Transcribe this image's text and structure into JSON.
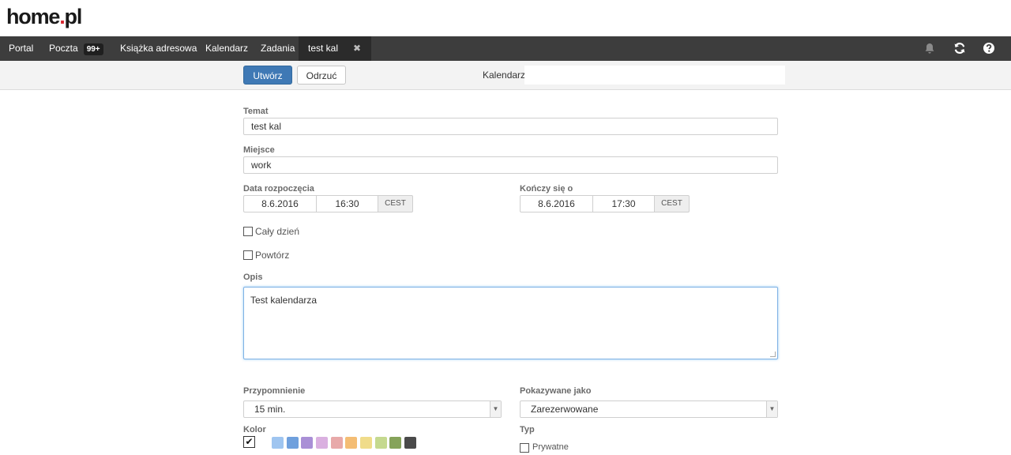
{
  "brand": {
    "name": "home",
    "dot": ".",
    "tld": "pl"
  },
  "nav": {
    "items": [
      {
        "label": "Portal"
      },
      {
        "label": "Poczta",
        "badge": "99+"
      },
      {
        "label": "Książka adresowa"
      },
      {
        "label": "Kalendarz"
      },
      {
        "label": "Zadania"
      },
      {
        "label": "test kal",
        "active": true
      }
    ],
    "close_icon": "✖",
    "right_icons": [
      "bell-icon",
      "refresh-icon",
      "help-icon"
    ]
  },
  "toolbar": {
    "create_label": "Utwórz",
    "discard_label": "Odrzuć",
    "calendar_label": "Kalendarz:",
    "calendar_value": ""
  },
  "form": {
    "subject": {
      "label": "Temat",
      "value": "test kal"
    },
    "location": {
      "label": "Miejsce",
      "value": "work"
    },
    "start": {
      "label": "Data rozpoczęcia",
      "date": "8.6.2016",
      "time": "16:30",
      "tz": "CEST"
    },
    "end": {
      "label": "Kończy się o",
      "date": "8.6.2016",
      "time": "17:30",
      "tz": "CEST"
    },
    "all_day": {
      "label": "Cały dzień",
      "checked": false
    },
    "repeat": {
      "label": "Powtórz",
      "checked": false
    },
    "description": {
      "label": "Opis",
      "value": "Test kalendarza"
    },
    "reminder": {
      "label": "Przypomnienie",
      "value": "15 min."
    },
    "show_as": {
      "label": "Pokazywane jako",
      "value": "Zarezerwowane"
    },
    "color": {
      "label": "Kolor",
      "check": "✔",
      "swatches": [
        "#9fc5f0",
        "#6fa0dd",
        "#a98fd6",
        "#dab0e0",
        "#e8a9a9",
        "#f4bd74",
        "#f0dc8a",
        "#c5d98f",
        "#86a35a",
        "#4a4a4a"
      ]
    },
    "type": {
      "label": "Typ",
      "private_label": "Prywatne",
      "private_checked": false
    }
  },
  "colors": {
    "accent": "#3f79b5",
    "nav_bg": "#3d3d3d",
    "brand_red": "#d7262f"
  }
}
